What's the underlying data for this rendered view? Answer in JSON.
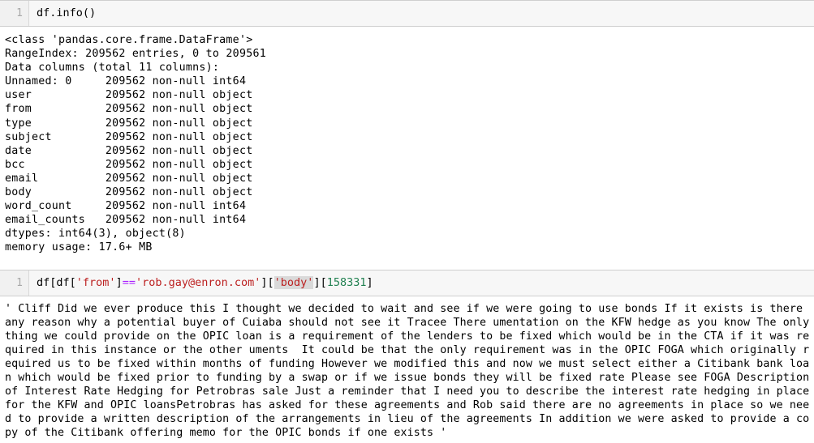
{
  "notebook": {
    "cells": [
      {
        "kind": "code",
        "prompt_label": "1",
        "source": "df.info()",
        "output_kind": "stream",
        "output_text": "<class 'pandas.core.frame.DataFrame'>\nRangeIndex: 209562 entries, 0 to 209561\nData columns (total 11 columns):\nUnnamed: 0     209562 non-null int64\nuser           209562 non-null object\nfrom           209562 non-null object\ntype           209562 non-null object\nsubject        209562 non-null object\ndate           209562 non-null object\nbcc            209562 non-null object\nemail          209562 non-null object\nbody           209562 non-null object\nword_count     209562 non-null int64\nemail_counts   209562 non-null int64\ndtypes: int64(3), object(8)\nmemory usage: 17.6+ MB"
      },
      {
        "kind": "code",
        "prompt_label": "1",
        "source_tokens": [
          {
            "text": "df[df[",
            "type": "plain"
          },
          {
            "text": "'from'",
            "type": "string"
          },
          {
            "text": "]",
            "type": "plain"
          },
          {
            "text": "==",
            "type": "operator"
          },
          {
            "text": "'rob.gay@enron.com'",
            "type": "string"
          },
          {
            "text": "][",
            "type": "plain"
          },
          {
            "text": "'body'",
            "type": "string-highlighted"
          },
          {
            "text": "][",
            "type": "plain"
          },
          {
            "text": "158331",
            "type": "number"
          },
          {
            "text": "]",
            "type": "plain"
          }
        ],
        "output_kind": "execute_result",
        "output_text": "' Cliff Did we ever produce this I thought we decided to wait and see if we were going to use bonds If it exists is there any reason why a potential buyer of Cuiaba should not see it Tracee There umentation on the KFW hedge as you know The only thing we could provide on the OPIC loan is a requirement of the lenders to be fixed which would be in the CTA if it was required in this instance or the other uments  It could be that the only requirement was in the OPIC FOGA which originally required us to be fixed within months of funding However we modified this and now we must select either a Citibank bank loan which would be fixed prior to funding by a swap or if we issue bonds they will be fixed rate Please see FOGA Description of Interest Rate Hedging for Petrobras sale Just a reminder that I need you to describe the interest rate hedging in place for the KFW and OPIC loansPetrobras has asked for these agreements and Rob said there are no agreements in place so we need to provide a written description of the arrangements in lieu of the agreements In addition we were asked to provide a copy of the Citibank offering memo for the OPIC bonds if one exists '"
      }
    ]
  },
  "colors": {
    "cell_input_bg": "#f7f7f7",
    "prompt_bg": "#f1f1f1",
    "prompt_text": "#a8a8a8",
    "cell_border": "#cfcfcf",
    "string_token": "#bc2121",
    "operator_token": "#aa22ff",
    "number_token": "#208050",
    "highlight_bg": "#d9d9d9",
    "output_text": "#000000",
    "page_bg": "#ffffff"
  }
}
